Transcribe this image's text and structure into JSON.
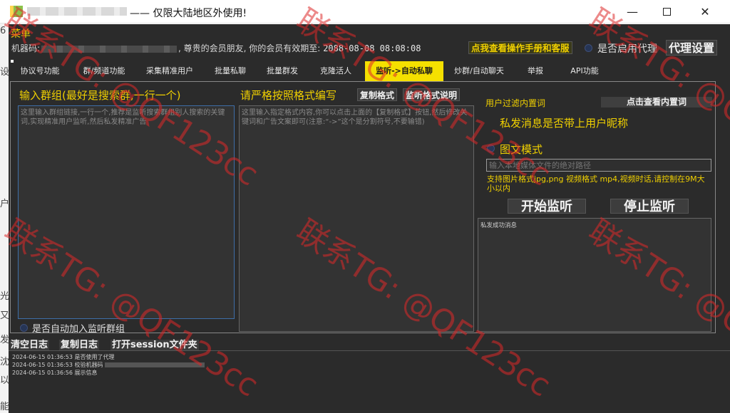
{
  "window": {
    "title": "—— 仅限大陆地区外使用!",
    "minimize": "—",
    "close": "✕"
  },
  "background_edge": [
    "6",
    "设",
    "户",
    "光",
    "又",
    "发",
    "沈",
    "以",
    "能"
  ],
  "menu": {
    "label": "菜单"
  },
  "header": {
    "machine_label": "机器码:",
    "member_text": ", 尊贵的会员朋友, 你的会员有效期至:",
    "expire_date": "2088-08-08 08:08:08",
    "manual_button": "点我查看操作手册和客服",
    "proxy_toggle_label": "是否启用代理",
    "proxy_settings_button": "代理设置"
  },
  "tabs": [
    {
      "label": "协议号功能",
      "active": false
    },
    {
      "label": "群/频道功能",
      "active": false
    },
    {
      "label": "采集精准用户",
      "active": false
    },
    {
      "label": "批量私聊",
      "active": false
    },
    {
      "label": "批量群发",
      "active": false
    },
    {
      "label": "克隆活人",
      "active": false
    },
    {
      "label": "监听->自动私聊",
      "active": true
    },
    {
      "label": "炒群/自动聊天",
      "active": false
    },
    {
      "label": "举报",
      "active": false
    },
    {
      "label": "API功能",
      "active": false
    }
  ],
  "monitor": {
    "group_input_label": "输入群组(最好是搜索群,一行一个)",
    "group_input_placeholder": "这里输入群组链接,一行一个,推荐是监听搜索群组别人搜索的关键词,实现精准用户监听,然后私发精准广告",
    "format_label": "请严格按照格式编写",
    "copy_format_button": "复制格式",
    "monitor_format_help_button": "监听格式说明",
    "format_placeholder": "这里输入指定格式内容,你可以点击上面的【复制格式】按钮,然后修改关键词和广告文案即可(注意:“->”这个是分割符号,不要输错)",
    "auto_join_label": "是否自动加入监听群组",
    "filter_words_label": "用户过滤内置词",
    "view_filter_words_button": "点击查看内置词",
    "nickname_label": "私发消息是否带上用户昵称",
    "media_mode_label": "图文模式",
    "media_path_placeholder": "输入本地媒体文件的绝对路径",
    "media_hint": "支持图片格式jpg,png 视频格式 mp4,视频时话,请控制在9M大小以内",
    "start_button": "开始监听",
    "stop_button": "停止监听",
    "success_log_title": "私发成功消息"
  },
  "bottom": {
    "clear_log_button": "清空日志",
    "copy_log_button": "复制日志",
    "open_session_button": "打开session文件夹"
  },
  "log": [
    "2024-06-15 01:36:53 是否使用了代理",
    "2024-06-15 01:36:53 校验机器码",
    "2024-06-15 01:36:56 展示信息"
  ],
  "watermark": "联系TG: @QF123cc",
  "colors": {
    "accent_yellow": "#f0d000",
    "panel_bg": "#2b2b2b",
    "active_tab_bg": "#f5e000",
    "watermark_red": "#dc2828"
  }
}
